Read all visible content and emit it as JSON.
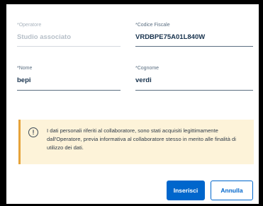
{
  "form": {
    "operatore": {
      "label": "*Operatore",
      "value": "Studio associato",
      "disabled": true
    },
    "codice_fiscale": {
      "label": "*Codice Fiscale",
      "value": "VRDBPE75A01L840W"
    },
    "nome": {
      "label": "*Nome",
      "value": "bepi"
    },
    "cognome": {
      "label": "*Cognome",
      "value": "verdi"
    }
  },
  "alert": {
    "icon": "exclamation-circle-icon",
    "icon_glyph": "!",
    "text": "I dati personali riferiti al collaboratore, sono stati acquisiti legittimamente dall'Operatore, previa informativa al collaboratore stesso in merito alle finalità di utilizzo dei dati.",
    "background": "#fdf3d9",
    "accent": "#e6a33a"
  },
  "actions": {
    "insert_label": "Inserisci",
    "cancel_label": "Annulla",
    "primary_color": "#0066cc"
  }
}
